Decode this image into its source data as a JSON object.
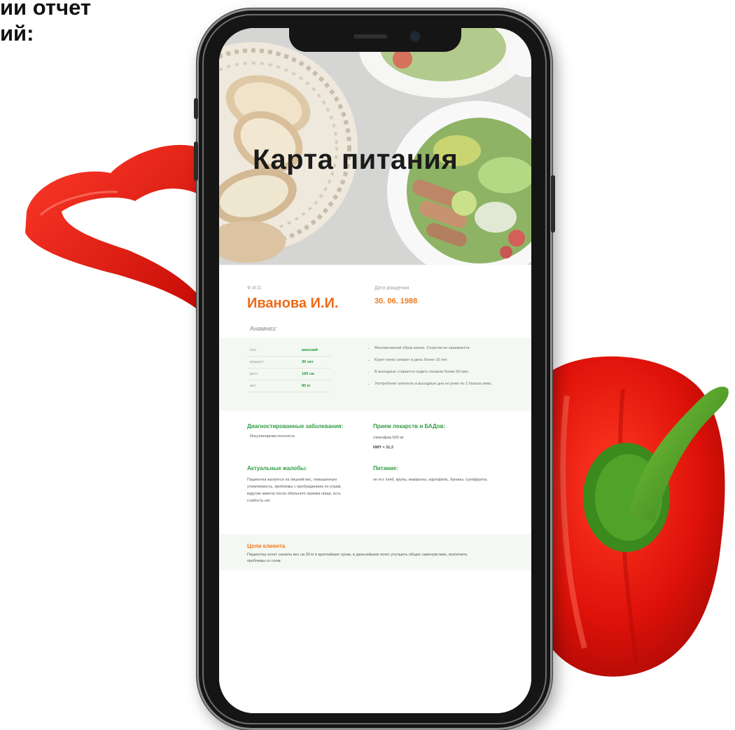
{
  "page": {
    "heading_lines": [
      "ии отчет",
      "ий:"
    ],
    "colors": {
      "accent_orange": "#ee6a16",
      "accent_green": "#2f9e44",
      "pepper_red": "#e3140d"
    }
  },
  "document": {
    "title": "Карта питания",
    "fio_label": "Ф.И.О.",
    "name": "Иванова И.И.",
    "dob_label": "Дата рождения",
    "dob": "30. 06. 1988",
    "anamnez_label": "Анамнез:",
    "stats": [
      {
        "label": "пол",
        "value": "женский"
      },
      {
        "label": "возраст",
        "value": "30 лет"
      },
      {
        "label": "рост",
        "value": "160 см"
      },
      {
        "label": "вес",
        "value": "80 кг"
      }
    ],
    "bullets": [
      "Малоактивный образ жизни. Спортом не занимается.",
      "Курит пачку сигарет в день более 10 лет.",
      "В выходные старается ходить пешком более 60 мин.",
      "Употребляет алкоголь в выходные дни не реже по 2 бокала пива."
    ],
    "diagnosed_heading": "Диагностированные заболевания:",
    "diagnosed_text": "Инсулинорезистентность",
    "meds_heading": "Прием лекарств и БАДов:",
    "meds_text": "глюкофаж 500 мг",
    "bmi_text": "ИМТ = 31,3",
    "complaints_heading": "Актуальные жалобы:",
    "complaints_text": "Пациентка жалуется на лишний вес, повышенную утомляемость, проблемы с пробуждением по утрам, вздутие живота после обильного приема пищи, есть слабость ног",
    "nutrition_heading": "Питание:",
    "nutrition_text": "не ест хлеб, крупы, макароны, картофель, бананы, сухофрукты.",
    "goals_heading": "Цели клиента",
    "goals_text": "Пациентка хочет снизить вес на 30 кг в кратчайшие сроки, в дальнейшем хочет улучшить общее самочувствие, исключить проблемы со сном."
  }
}
